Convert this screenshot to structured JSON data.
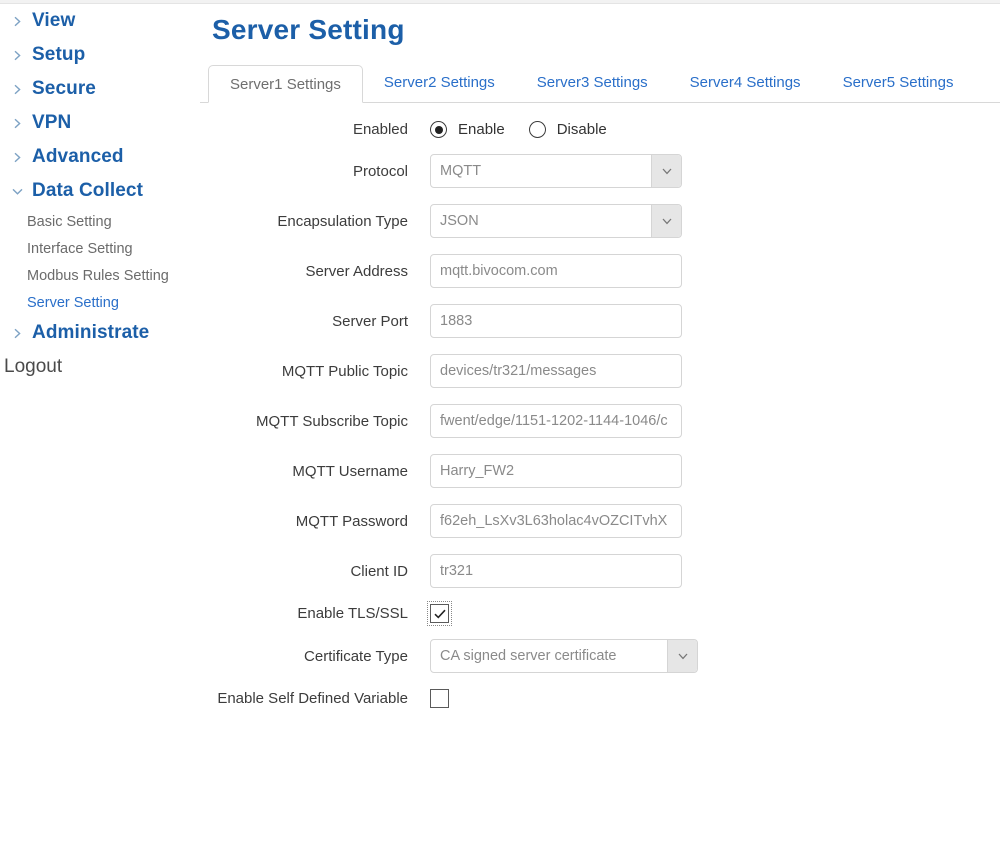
{
  "sidebar": {
    "top_items": [
      {
        "label": "View",
        "icon": "chevron-right-icon",
        "expanded": false
      },
      {
        "label": "Setup",
        "icon": "chevron-right-icon",
        "expanded": false
      },
      {
        "label": "Secure",
        "icon": "chevron-right-icon",
        "expanded": false
      },
      {
        "label": "VPN",
        "icon": "chevron-right-icon",
        "expanded": false
      },
      {
        "label": "Advanced",
        "icon": "chevron-right-icon",
        "expanded": false
      },
      {
        "label": "Data Collect",
        "icon": "chevron-down-icon",
        "expanded": true
      }
    ],
    "sub_items": [
      {
        "label": "Basic Setting",
        "active": false
      },
      {
        "label": "Interface Setting",
        "active": false
      },
      {
        "label": "Modbus Rules Setting",
        "active": false
      },
      {
        "label": "Server Setting",
        "active": true
      }
    ],
    "administrate": {
      "label": "Administrate",
      "icon": "chevron-right-icon"
    },
    "logout": {
      "label": "Logout"
    }
  },
  "main": {
    "title": "Server Setting",
    "tabs": [
      {
        "label": "Server1 Settings",
        "active": true
      },
      {
        "label": "Server2 Settings",
        "active": false
      },
      {
        "label": "Server3 Settings",
        "active": false
      },
      {
        "label": "Server4 Settings",
        "active": false
      },
      {
        "label": "Server5 Settings",
        "active": false
      }
    ],
    "form": {
      "enabled": {
        "label": "Enabled",
        "options": [
          {
            "label": "Enable",
            "selected": true
          },
          {
            "label": "Disable",
            "selected": false
          }
        ]
      },
      "protocol": {
        "label": "Protocol",
        "value": "MQTT"
      },
      "encapsulation_type": {
        "label": "Encapsulation Type",
        "value": "JSON"
      },
      "server_address": {
        "label": "Server Address",
        "value": "mqtt.bivocom.com"
      },
      "server_port": {
        "label": "Server Port",
        "value": "1883"
      },
      "mqtt_public_topic": {
        "label": "MQTT Public Topic",
        "value": "devices/tr321/messages"
      },
      "mqtt_subscribe_topic": {
        "label": "MQTT Subscribe Topic",
        "value": "fwent/edge/1151-1202-1144-1046/c"
      },
      "mqtt_username": {
        "label": "MQTT Username",
        "value": "Harry_FW2"
      },
      "mqtt_password": {
        "label": "MQTT Password",
        "value": "f62eh_LsXv3L63holac4vOZCITvhX"
      },
      "client_id": {
        "label": "Client ID",
        "value": "tr321"
      },
      "enable_tls_ssl": {
        "label": "Enable TLS/SSL",
        "checked": true
      },
      "certificate_type": {
        "label": "Certificate Type",
        "value": "CA signed server certificate"
      },
      "enable_self_defined_variable": {
        "label": "Enable Self Defined Variable",
        "checked": false
      }
    }
  },
  "colors": {
    "nav_blue": "#1c5fa8",
    "link_blue": "#2a6fc9",
    "muted_text": "#8a8a8a",
    "border": "#d5d5d5"
  }
}
